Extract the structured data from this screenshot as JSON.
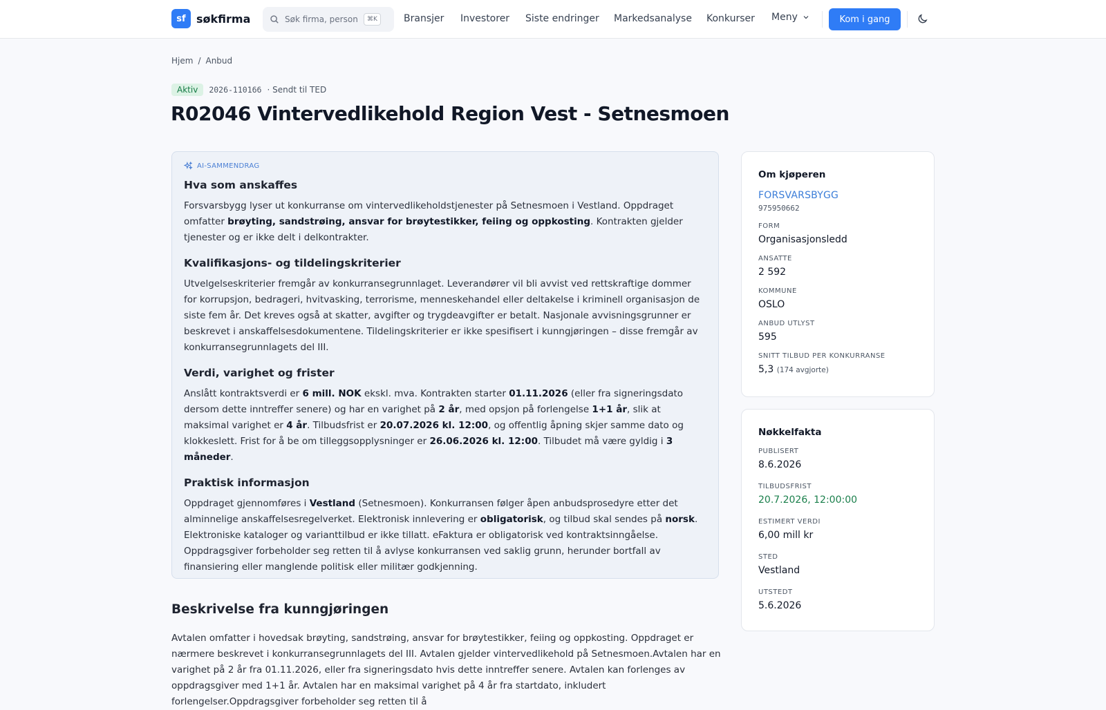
{
  "header": {
    "logo_badge": "sf",
    "logo_text": "søkfirma",
    "search_placeholder": "Søk firma, person...",
    "search_shortcut": "⌘K",
    "nav": [
      "Bransjer",
      "Investorer",
      "Siste endringer",
      "Markedsanalyse",
      "Konkurser"
    ],
    "menu_label": "Meny",
    "cta_label": "Kom i gang"
  },
  "breadcrumb": {
    "home": "Hjem",
    "separator": "/",
    "current": "Anbud"
  },
  "meta": {
    "status": "Aktiv",
    "id": "2026-110166",
    "sent": "· Sendt til TED"
  },
  "title": "R02046 Vintervedlikehold Region Vest - Setnesmoen",
  "ai_summary": {
    "label": "AI-SAMMENDRAG",
    "s1_heading": "Hva som anskaffes",
    "s1_a": "Forsvarsbygg lyser ut konkurranse om vintervedlikeholdstjenester på Setnesmoen i Vestland. Oppdraget omfatter ",
    "s1_b": "brøyting, sandstrøing, ansvar for brøytestikker, feiing og oppkosting",
    "s1_c": ". Kontrakten gjelder tjenester og er ikke delt i delkontrakter.",
    "s2_heading": "Kvalifikasjons- og tildelingskriterier",
    "s2_text": "Utvelgelseskriterier fremgår av konkurransegrunnlaget. Leverandører vil bli avvist ved rettskraftige dommer for korrupsjon, bedrageri, hvitvasking, terrorisme, menneskehandel eller deltakelse i kriminell organisasjon de siste fem år. Det kreves også at skatter, avgifter og trygdeavgifter er betalt. Nasjonale avvisningsgrunner er beskrevet i anskaffelsesdokumentene. Tildelingskriterier er ikke spesifisert i kunngjøringen – disse fremgår av konkurransegrunnlagets del III.",
    "s3_heading": "Verdi, varighet og frister",
    "s3_1": "Anslått kontraktsverdi er ",
    "s3_2": "6 mill. NOK",
    "s3_3": " ekskl. mva. Kontrakten starter ",
    "s3_4": "01.11.2026",
    "s3_5": " (eller fra signeringsdato dersom dette inntreffer senere) og har en varighet på ",
    "s3_6": "2 år",
    "s3_7": ", med opsjon på forlengelse ",
    "s3_8": "1+1 år",
    "s3_9": ", slik at maksimal varighet er ",
    "s3_10": "4 år",
    "s3_11": ". Tilbudsfrist er ",
    "s3_12": "20.07.2026 kl. 12:00",
    "s3_13": ", og offentlig åpning skjer samme dato og klokkeslett. Frist for å be om tilleggsopplysninger er ",
    "s3_14": "26.06.2026 kl. 12:00",
    "s3_15": ". Tilbudet må være gyldig i ",
    "s3_16": "3 måneder",
    "s3_17": ".",
    "s4_heading": "Praktisk informasjon",
    "s4_1": "Oppdraget gjennomføres i ",
    "s4_2": "Vestland",
    "s4_3": " (Setnesmoen). Konkurransen følger åpen anbudsprosedyre etter det alminnelige anskaffelsesregelverket. Elektronisk innlevering er ",
    "s4_4": "obligatorisk",
    "s4_5": ", og tilbud skal sendes på ",
    "s4_6": "norsk",
    "s4_7": ". Elektroniske kataloger og varianttilbud er ikke tillatt. eFaktura er obligatorisk ved kontraktsinngåelse. Oppdragsgiver forbeholder seg retten til å avlyse konkurransen ved saklig grunn, herunder bortfall av finansiering eller manglende politisk eller militær godkjenning."
  },
  "description": {
    "heading": "Beskrivelse fra kunngjøringen",
    "text": "Avtalen omfatter i hovedsak brøyting, sandstrøing, ansvar for brøytestikker, feiing og oppkosting. Oppdraget er nærmere beskrevet i konkurransegrunnlagets del III. Avtalen gjelder vintervedlikehold på Setnesmoen.Avtalen har en varighet på 2 år fra 01.11.2026, eller fra signeringsdato hvis dette inntreffer senere. Avtalen kan forlenges av oppdragsgiver med 1+1 år. Avtalen har en maksimal varighet på 4 år fra startdato, inkludert forlengelser.Oppdragsgiver forbeholder seg retten til å"
  },
  "buyer": {
    "heading": "Om kjøperen",
    "name": "FORSVARSBYGG",
    "orgnr": "975950662",
    "form_label": "FORM",
    "form": "Organisasjonsledd",
    "employees_label": "ANSATTE",
    "employees": "2 592",
    "municipality_label": "KOMMUNE",
    "municipality": "OSLO",
    "tenders_label": "ANBUD UTLYST",
    "tenders": "595",
    "avg_label": "SNITT TILBUD PER KONKURRANSE",
    "avg": "5,3",
    "avg_note": "(174 avgjorte)"
  },
  "keyfacts": {
    "heading": "Nøkkelfakta",
    "published_label": "PUBLISERT",
    "published": "8.6.2026",
    "deadline_label": "TILBUDSFRIST",
    "deadline": "20.7.2026, 12:00:00",
    "value_label": "ESTIMERT VERDI",
    "value": "6,00 mill kr",
    "place_label": "STED",
    "place": "Vestland",
    "issued_label": "UTSTEDT",
    "issued": "5.6.2026"
  },
  "colors": {
    "accent": "#2f7cf6",
    "active_badge_bg": "#dcf2e5",
    "active_badge_text": "#157a45",
    "deadline": "#1a7f4b"
  }
}
